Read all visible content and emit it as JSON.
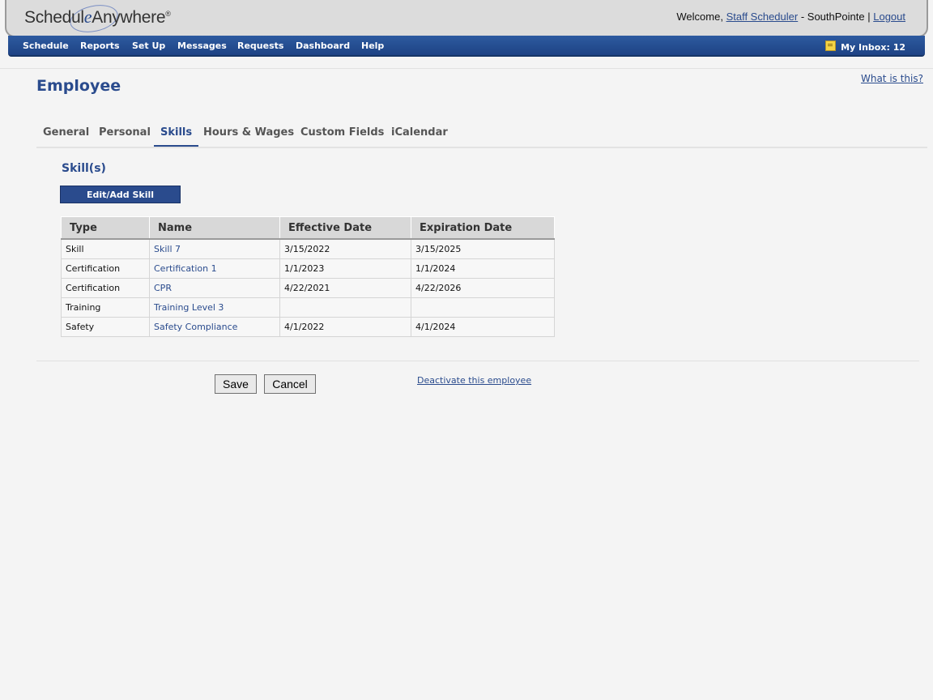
{
  "header": {
    "logo_text_1": "Schedul",
    "logo_text_e": "e",
    "logo_text_2": "Anywhere",
    "logo_reg": "®",
    "welcome_prefix": "Welcome,",
    "user_name": "Staff Scheduler",
    "location": "- SouthPointe |",
    "logout": "Logout"
  },
  "nav": {
    "items": [
      "Schedule",
      "Reports",
      "Set Up",
      "Messages",
      "Requests",
      "Dashboard",
      "Help"
    ],
    "inbox_label": "My Inbox: 12"
  },
  "page": {
    "title": "Employee",
    "help_link": "What is this?"
  },
  "tabs": [
    "General",
    "Personal",
    "Skills",
    "Hours & Wages",
    "Custom Fields",
    "iCalendar"
  ],
  "active_tab": "Skills",
  "skills": {
    "section_title": "Skill(s)",
    "edit_button": "Edit/Add Skill",
    "columns": [
      "Type",
      "Name",
      "Effective Date",
      "Expiration Date"
    ],
    "rows": [
      {
        "type": "Skill",
        "name": "Skill 7",
        "effective": "3/15/2022",
        "expiration": "3/15/2025"
      },
      {
        "type": "Certification",
        "name": "Certification 1",
        "effective": "1/1/2023",
        "expiration": "1/1/2024"
      },
      {
        "type": "Certification",
        "name": "CPR",
        "effective": "4/22/2021",
        "expiration": "4/22/2026"
      },
      {
        "type": "Training",
        "name": "Training Level 3",
        "effective": "",
        "expiration": ""
      },
      {
        "type": "Safety",
        "name": "Safety Compliance",
        "effective": "4/1/2022",
        "expiration": "4/1/2024"
      }
    ]
  },
  "footer": {
    "save": "Save",
    "cancel": "Cancel",
    "deactivate": "Deactivate this employee"
  },
  "colors": {
    "brand_blue": "#2a4b8d",
    "nav_blue": "#1e4384",
    "background": "#f4f4f4"
  }
}
